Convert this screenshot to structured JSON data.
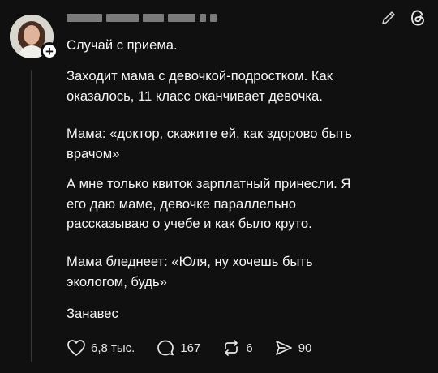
{
  "post": {
    "paragraphs": [
      "Случай с приема.",
      "Заходит мама с девочкой-подростком. Как\nоказалось, 11 класс оканчивает девочка.",
      "Мама: «доктор, скажите ей, как здорово быть\nврачом»",
      "А мне только квиток зарплатный принесли. Я\nего даю маме, девочке параллельно\nрассказываю о учебе и как было круто.",
      "Мама бледнеет: «Юля, ну хочешь быть\nэкологом, будь»",
      "Занавес"
    ]
  },
  "actions": {
    "likes": "6,8 тыс.",
    "replies": "167",
    "reposts": "6",
    "shares": "90"
  },
  "icons": {
    "follow": "plus-icon",
    "edit": "pencil-icon",
    "app": "threads-logo-icon",
    "like": "heart-icon",
    "reply": "comment-icon",
    "repost": "repost-icon",
    "share": "send-icon"
  },
  "colors": {
    "background": "#101010",
    "text": "#f3f5f7",
    "thread_line": "#3a3a3a"
  }
}
